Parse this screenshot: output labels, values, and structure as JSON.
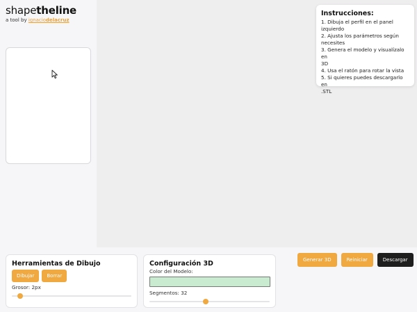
{
  "app": {
    "title_regular": "shape",
    "title_bold": "theline",
    "subtitle_prefix": "a tool by ",
    "author_regular": "ignacio",
    "author_bold": "delacruz",
    "accent_color": "#f0a840"
  },
  "instructions": {
    "title": "Instrucciones:",
    "steps": [
      "1. Dibuja el perfil en el panel",
      "izquierdo",
      "2. Ajusta los parámetros según",
      "necesites",
      "3. Genera el modelo y visualízalo en",
      "3D",
      "4. Usa el ratón para rotar la vista",
      "5. Si quieres puedes descargarlo en",
      ".STL"
    ]
  },
  "drawing_tools": {
    "title": "Herramientas de Dibujo",
    "draw_label": "Dibujar",
    "erase_label": "Borrar",
    "thickness_label": "Grosor: 2px",
    "thickness_fraction": 0.07
  },
  "config3d": {
    "title": "Configuración 3D",
    "color_label": "Color del Modelo:",
    "model_color": "#c9ecd1",
    "segments_label": "Segmentos: 32",
    "segments_fraction": 0.47
  },
  "actions": {
    "generate_label": "Generar 3D",
    "reset_label": "Reiniciar",
    "download_label": "Descargar"
  },
  "icons": {
    "cursor": "mouse-pointer-icon"
  }
}
